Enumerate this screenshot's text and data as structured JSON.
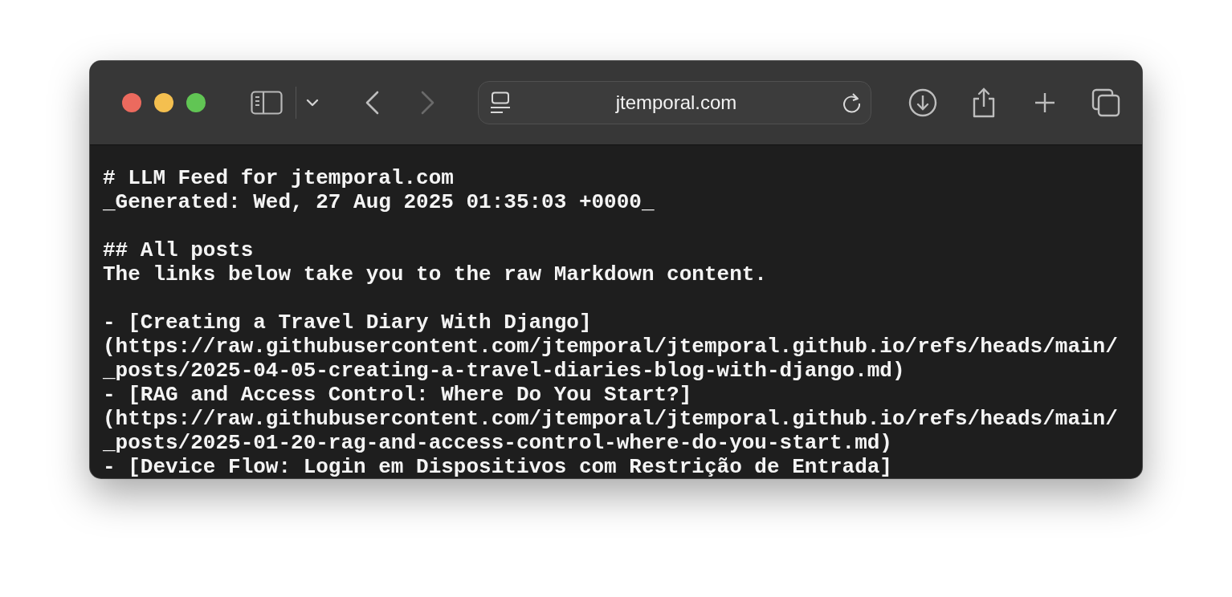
{
  "window": {
    "address": "jtemporal.com",
    "back_disabled": false,
    "forward_disabled": true
  },
  "document": {
    "blocks": [
      [
        "# LLM Feed for jtemporal.com",
        "_Generated: Wed, 27 Aug 2025 01:35:03 +0000_"
      ],
      [
        "## All posts",
        "The links below take you to the raw Markdown content."
      ],
      [
        "- [Creating a Travel Diary With Django]",
        "(https://raw.githubusercontent.com/jtemporal/jtemporal.github.io/refs/heads/main/",
        "_posts/2025-04-05-creating-a-travel-diaries-blog-with-django.md)",
        "- [RAG and Access Control: Where Do You Start?]",
        "(https://raw.githubusercontent.com/jtemporal/jtemporal.github.io/refs/heads/main/",
        "_posts/2025-01-20-rag-and-access-control-where-do-you-start.md)",
        "- [Device Flow: Login em Dispositivos com Restrição de Entrada]"
      ]
    ]
  }
}
